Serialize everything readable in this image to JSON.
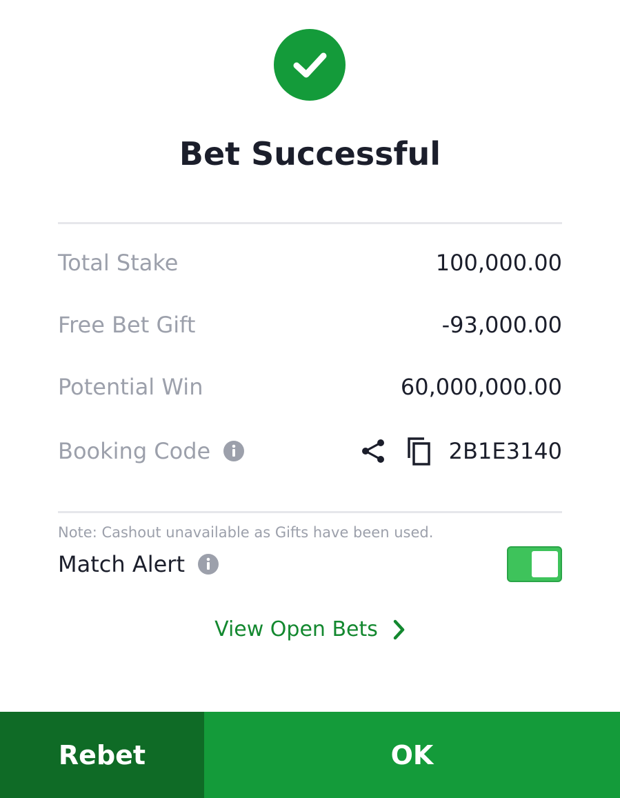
{
  "header": {
    "title": "Bet Successful",
    "status_icon": "check-circle-icon",
    "accent_color": "#149b3a"
  },
  "summary": {
    "total_stake_label": "Total Stake",
    "total_stake_value": "100,000.00",
    "free_bet_label": "Free Bet Gift",
    "free_bet_value": "-93,000.00",
    "potential_win_label": "Potential Win",
    "potential_win_value": "60,000,000.00",
    "booking_code_label": "Booking Code",
    "booking_code_value": "2B1E3140"
  },
  "note": "Note: Cashout unavailable as Gifts have been used.",
  "match_alert": {
    "label": "Match Alert",
    "enabled": true
  },
  "links": {
    "view_open_bets": "View Open Bets"
  },
  "footer": {
    "rebet_label": "Rebet",
    "ok_label": "OK",
    "rebet_color": "#0f6b26",
    "ok_color": "#149b3a"
  }
}
